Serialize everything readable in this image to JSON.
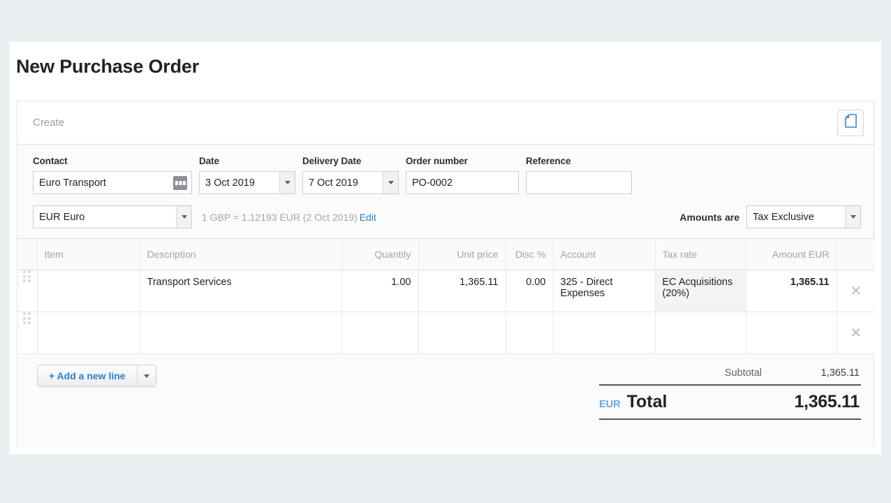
{
  "page": {
    "title": "New Purchase Order"
  },
  "panel": {
    "status_label": "Create",
    "doc_icon": "document-icon"
  },
  "form": {
    "contact": {
      "label": "Contact",
      "value": "Euro Transport",
      "picker_icon": "contact-picker-icon"
    },
    "date": {
      "label": "Date",
      "value": "3 Oct 2019"
    },
    "delivery_date": {
      "label": "Delivery Date",
      "value": "7 Oct 2019"
    },
    "order_number": {
      "label": "Order number",
      "value": "PO-0002"
    },
    "reference": {
      "label": "Reference",
      "value": "",
      "placeholder": ""
    }
  },
  "currency": {
    "value": "EUR Euro",
    "fx_note": "1 GBP = 1.12193 EUR (2 Oct 2019)",
    "edit_label": "Edit",
    "amounts_are_label": "Amounts are",
    "tax_mode": "Tax Exclusive"
  },
  "table": {
    "columns": [
      {
        "key": "item",
        "label": "Item",
        "align": "left"
      },
      {
        "key": "description",
        "label": "Description",
        "align": "left"
      },
      {
        "key": "quantity",
        "label": "Quantity",
        "align": "right"
      },
      {
        "key": "unit_price",
        "label": "Unit price",
        "align": "right"
      },
      {
        "key": "disc",
        "label": "Disc %",
        "align": "right"
      },
      {
        "key": "account",
        "label": "Account",
        "align": "left"
      },
      {
        "key": "tax_rate",
        "label": "Tax rate",
        "align": "left"
      },
      {
        "key": "amount",
        "label": "Amount EUR",
        "align": "right"
      }
    ],
    "rows": [
      {
        "item": "",
        "description": "Transport Services",
        "quantity": "1.00",
        "unit_price": "1,365.11",
        "disc": "0.00",
        "account": "325 - Direct Expenses",
        "tax_rate": "EC Acquisitions (20%)",
        "amount": "1,365.11",
        "remove_icon": "close-icon"
      },
      {
        "item": "",
        "description": "",
        "quantity": "",
        "unit_price": "",
        "disc": "",
        "account": "",
        "tax_rate": "",
        "amount": "",
        "remove_icon": "close-icon"
      }
    ]
  },
  "footer": {
    "add_line_label": "+ Add a new line",
    "subtotal_label": "Subtotal",
    "subtotal_value": "1,365.11",
    "total_currency": "EUR",
    "total_label": "Total",
    "total_value": "1,365.11"
  },
  "colors": {
    "page_background": "#eaf0f2",
    "link": "#2c7fc4",
    "accent_blue": "#6ba7d6",
    "text": "#1f2326",
    "muted": "#9fa4a8"
  }
}
